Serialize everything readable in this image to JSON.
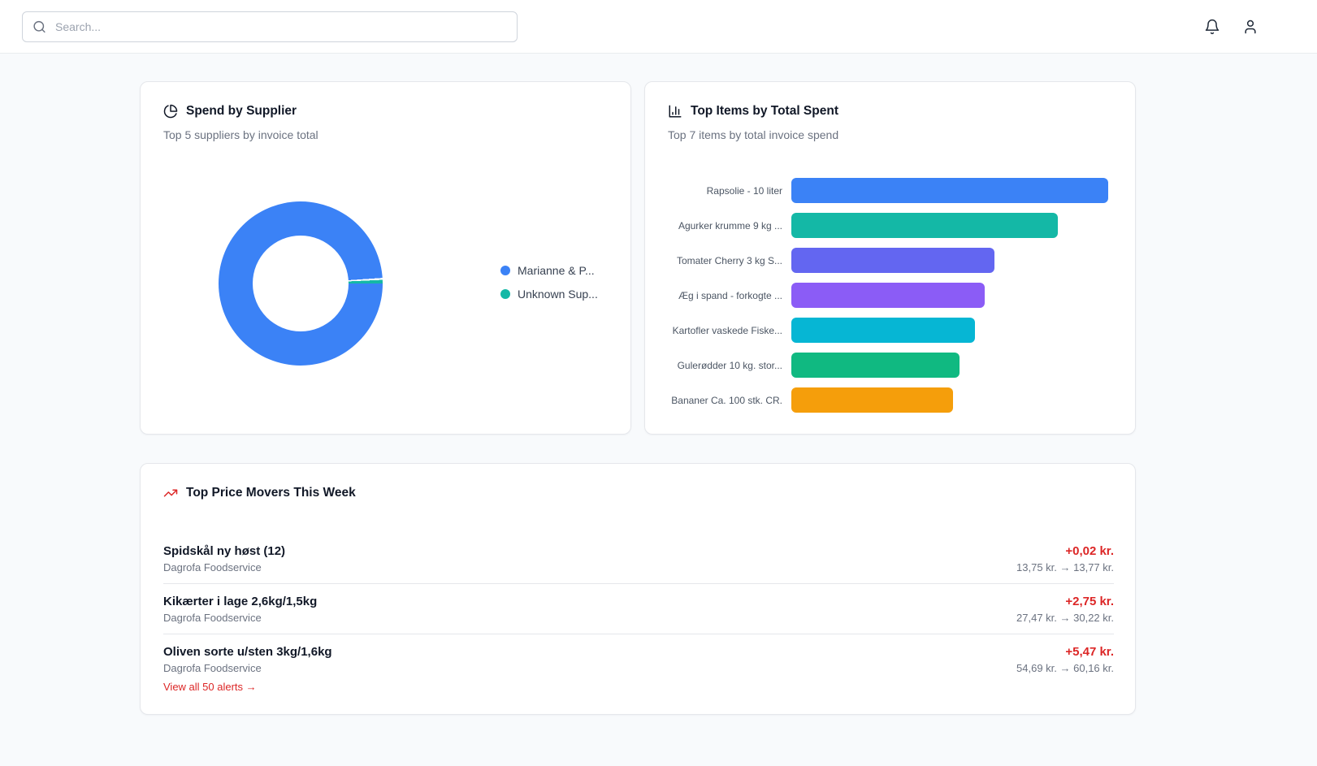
{
  "topbar": {
    "search_placeholder": "Search...",
    "icons": [
      "search-icon",
      "bell-icon",
      "user-icon"
    ]
  },
  "cards": {
    "spend_by_supplier": {
      "title": "Spend by Supplier",
      "subtitle": "Top 5 suppliers by invoice total"
    },
    "top_items": {
      "title": "Top Items by Total Spent",
      "subtitle": "Top 7 items by total invoice spend"
    },
    "price_movers": {
      "title": "Top Price Movers This Week",
      "items": [
        {
          "name": "Spidskål ny høst (12)",
          "supplier": "Dagrofa Foodservice",
          "delta": "+0,02 kr.",
          "range": "13,75 kr. → 13,77 kr."
        },
        {
          "name": "Kikærter i lage 2,6kg/1,5kg",
          "supplier": "Dagrofa Foodservice",
          "delta": "+2,75 kr.",
          "range": "27,47 kr. → 30,22 kr."
        },
        {
          "name": "Oliven sorte u/sten 3kg/1,6kg",
          "supplier": "Dagrofa Foodservice",
          "delta": "+5,47 kr.",
          "range": "54,69 kr. → 60,16 kr."
        }
      ],
      "view_all_label": "View all 50 alerts →"
    }
  },
  "colors": {
    "accent_red": "#dc2626",
    "donut_gap": "#ffffff"
  },
  "chart_data": [
    {
      "type": "pie",
      "title": "Spend by Supplier",
      "labels": [
        "Marianne & P...",
        "Unknown Sup..."
      ],
      "values": [
        99.3,
        0.7
      ],
      "values_unit": "percent_of_total_estimated",
      "colors": [
        "#3b82f6",
        "#14b8a6"
      ],
      "donut": true,
      "legend_position": "right"
    },
    {
      "type": "bar",
      "orientation": "horizontal",
      "title": "Top Items by Total Spent",
      "categories": [
        "Rapsolie - 10 liter",
        "Agurker krumme 9 kg ...",
        "Tomater Cherry 3 kg S...",
        "Æg i spand - forkogte ...",
        "Kartofler vaskede Fiske...",
        "Gulerødder 10 kg. stor...",
        "Bananer Ca. 100 stk. CR."
      ],
      "values": [
        100,
        84,
        64,
        61,
        58,
        53,
        51
      ],
      "values_unit": "relative_percent_of_longest_bar_estimated",
      "colors": [
        "#3b82f6",
        "#14b8a6",
        "#6366f1",
        "#8b5cf6",
        "#06b6d4",
        "#10b981",
        "#f59e0b"
      ],
      "grid": false,
      "axis_labels": false
    }
  ]
}
